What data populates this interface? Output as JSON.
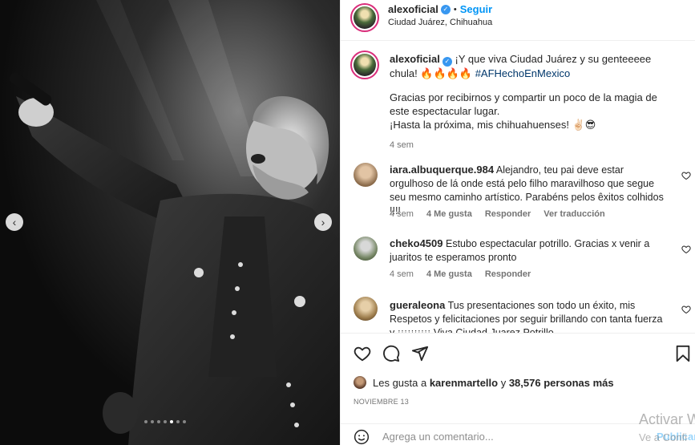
{
  "post": {
    "author": "alexoficial",
    "follow_label": "Seguir",
    "separator": "•",
    "location": "Ciudad Juárez, Chihuahua",
    "carousel": {
      "slide_count": 7,
      "active_index": 4
    }
  },
  "caption": {
    "author": "alexoficial",
    "line1": "¡Y que viva Ciudad Juárez y su genteeeee chula! 🔥🔥🔥🔥",
    "hashtag": "#AFHechoEnMexico",
    "line2": "Gracias por recibirnos y compartir un poco de la magia de este espectacular lugar.",
    "line3": "¡Hasta la próxima, mis chihuahuenses! ✌🏻😎",
    "time": "4 sem"
  },
  "comments": [
    {
      "user": "iara.albuquerque.984",
      "text": "Alejandro, teu pai deve estar orgulhoso de lá onde está pelo filho maravilhoso que segue seu mesmo caminho artístico. Parabéns pelos êxitos colhidos !!!!",
      "time": "4 sem",
      "likes": "4 Me gusta",
      "reply": "Responder",
      "translate": "Ver traducción"
    },
    {
      "user": "cheko4509",
      "text": "Estubo espectacular potrillo. Gracias x venir a juaritos te esperamos pronto",
      "time": "4 sem",
      "likes": "4 Me gusta",
      "reply": "Responder"
    },
    {
      "user": "gueraleona",
      "text": "Tus presentaciones son todo un éxito, mis Respetos y felicitaciones por seguir brillando con tanta fuerza y ¡¡¡¡¡¡¡¡¡¡ Viva Ciudad Juarez Potrillo"
    }
  ],
  "likes": {
    "prefix": "Les gusta a ",
    "first_user": "karenmartello",
    "middle": " y ",
    "count": "38,576 personas más"
  },
  "date": "NOVIEMBRE 13",
  "add_comment": {
    "placeholder": "Agrega un comentario...",
    "publish": "Publicar"
  },
  "watermark": {
    "line1": "Activar W",
    "line2": "Ve a Confi"
  },
  "colors": {
    "accent": "#0095f6",
    "verified": "#3897f0",
    "hashtag": "#00376b",
    "muted": "#737373"
  },
  "icons": [
    "verified-icon",
    "heart-icon",
    "comment-icon",
    "share-icon",
    "bookmark-icon",
    "emoji-icon",
    "chevron-left-icon",
    "chevron-right-icon"
  ]
}
